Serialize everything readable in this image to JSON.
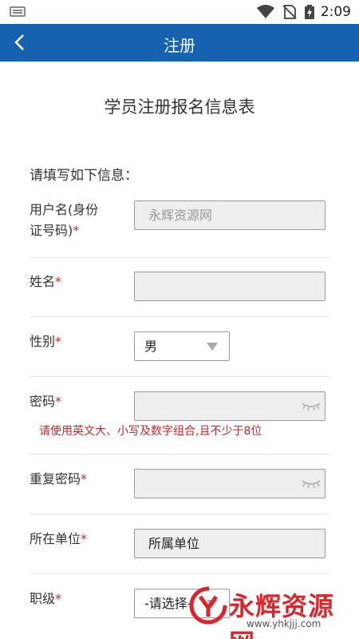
{
  "status_bar": {
    "time": "2:09",
    "icons": [
      "keyboard-icon",
      "wifi-icon",
      "no-sim-icon",
      "battery-charging-icon"
    ]
  },
  "header": {
    "title": "注册",
    "back_icon": "back-arrow-icon",
    "color": "#1661b0"
  },
  "form": {
    "title": "学员注册报名信息表",
    "intro": "请填写如下信息：",
    "required_mark": "*",
    "fields": {
      "username": {
        "label_line1": "用户名(身份",
        "label_line2": "证号码)",
        "placeholder": "永辉资源网"
      },
      "name": {
        "label": "姓名",
        "value": ""
      },
      "gender": {
        "label": "性别",
        "selected": "男"
      },
      "password": {
        "label": "密码",
        "value": "",
        "hint": "请使用英文大、小写及数字组合,且不少于8位"
      },
      "confirm_password": {
        "label": "重复密码",
        "value": ""
      },
      "unit": {
        "label": "所在单位",
        "value": "所属单位"
      },
      "rank": {
        "label": "职级",
        "selected": "-请选择-"
      }
    }
  },
  "watermark": {
    "text": "永辉资源网",
    "url": "www.yhkjjj.com"
  },
  "colors": {
    "required": "#c0282d",
    "watermark": "#d9262c"
  }
}
